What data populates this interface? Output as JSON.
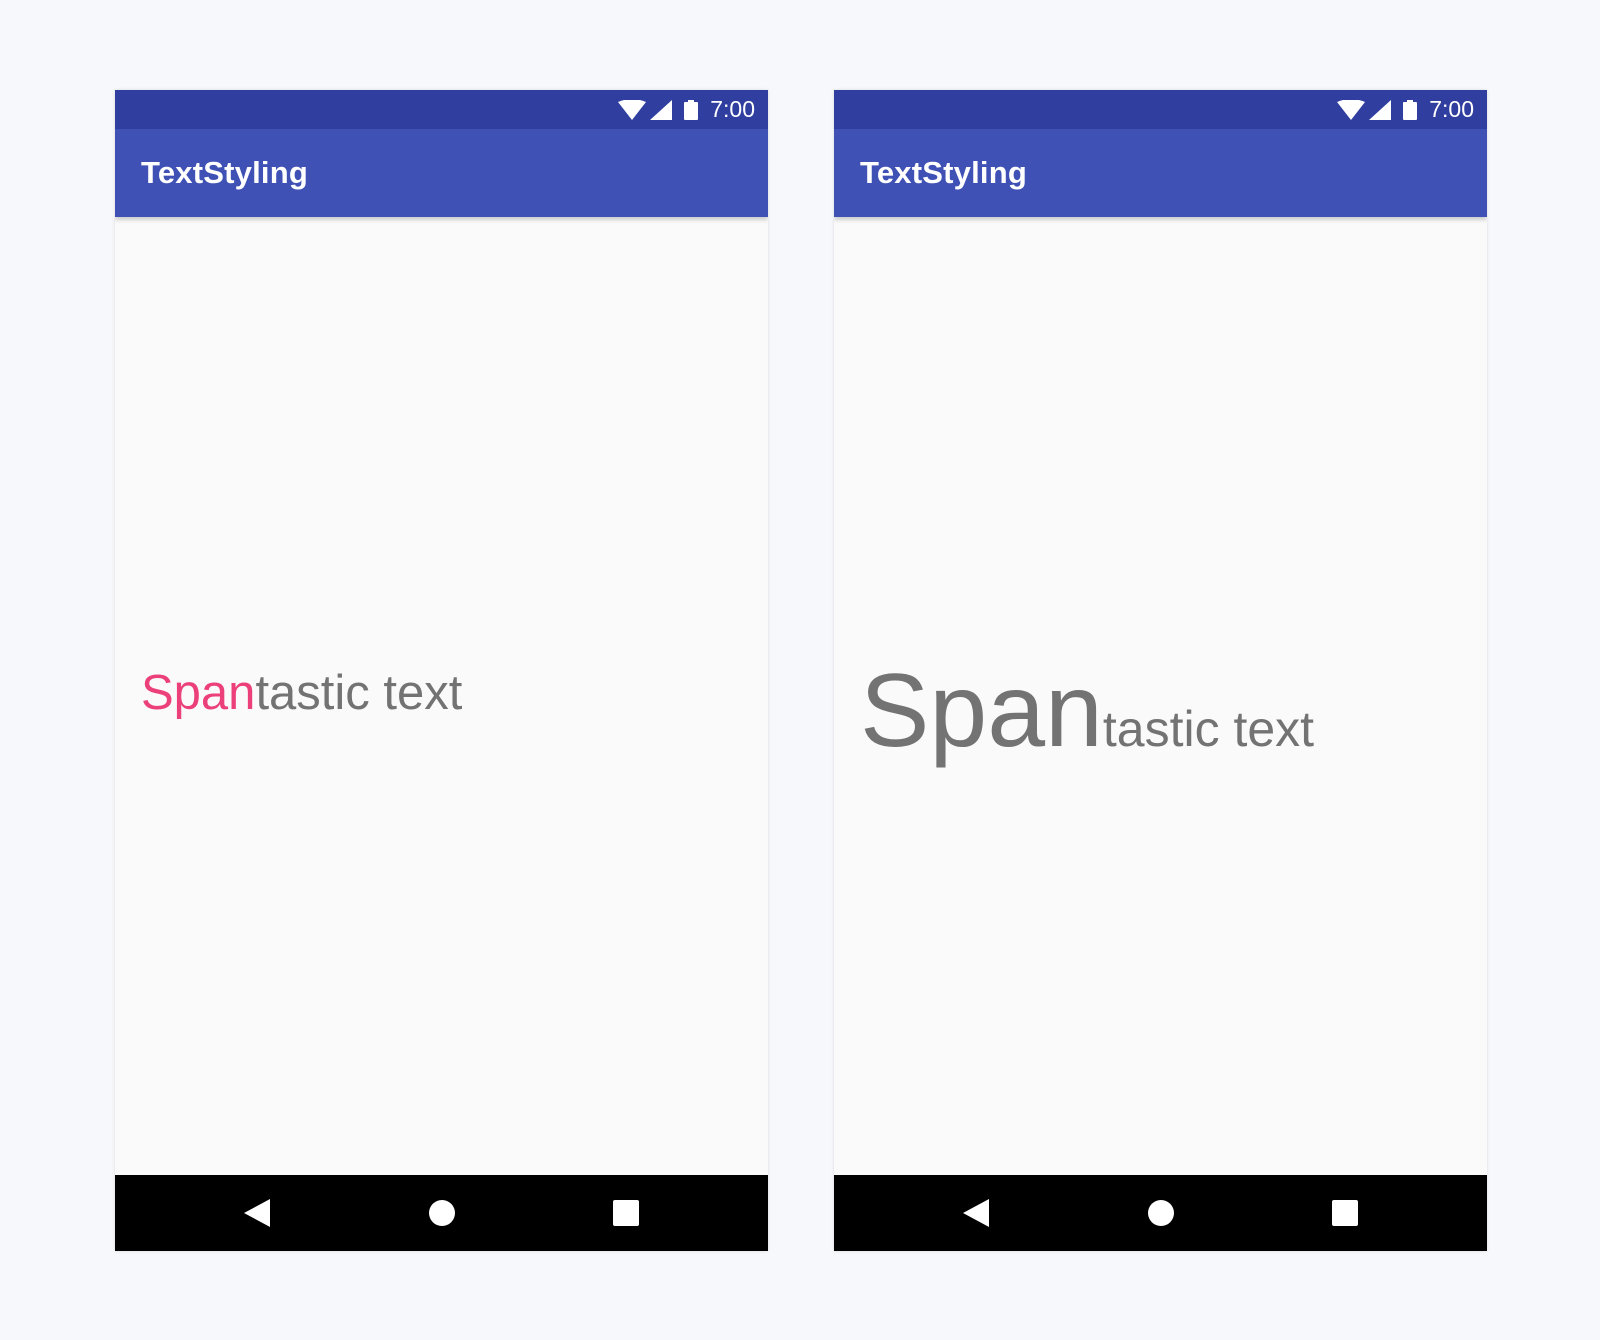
{
  "screens": [
    {
      "status_bar": {
        "time": "7:00"
      },
      "app_bar": {
        "title": "TextStyling"
      },
      "content": {
        "span_part": "Span",
        "rest_part": "tastic text"
      }
    },
    {
      "status_bar": {
        "time": "7:00"
      },
      "app_bar": {
        "title": "TextStyling"
      },
      "content": {
        "span_part": "Span",
        "rest_part": "tastic text"
      }
    }
  ],
  "icons": {
    "status": [
      "wifi-icon",
      "signal-icon",
      "battery-icon"
    ],
    "navigation": [
      "back-icon",
      "home-icon",
      "recents-icon"
    ]
  },
  "colors": {
    "status_bar": "#303f9f",
    "app_bar": "#3f51b5",
    "background": "#fafafa",
    "text": "#737373",
    "accent_pink": "#ec407a",
    "nav_bar": "#000000"
  }
}
